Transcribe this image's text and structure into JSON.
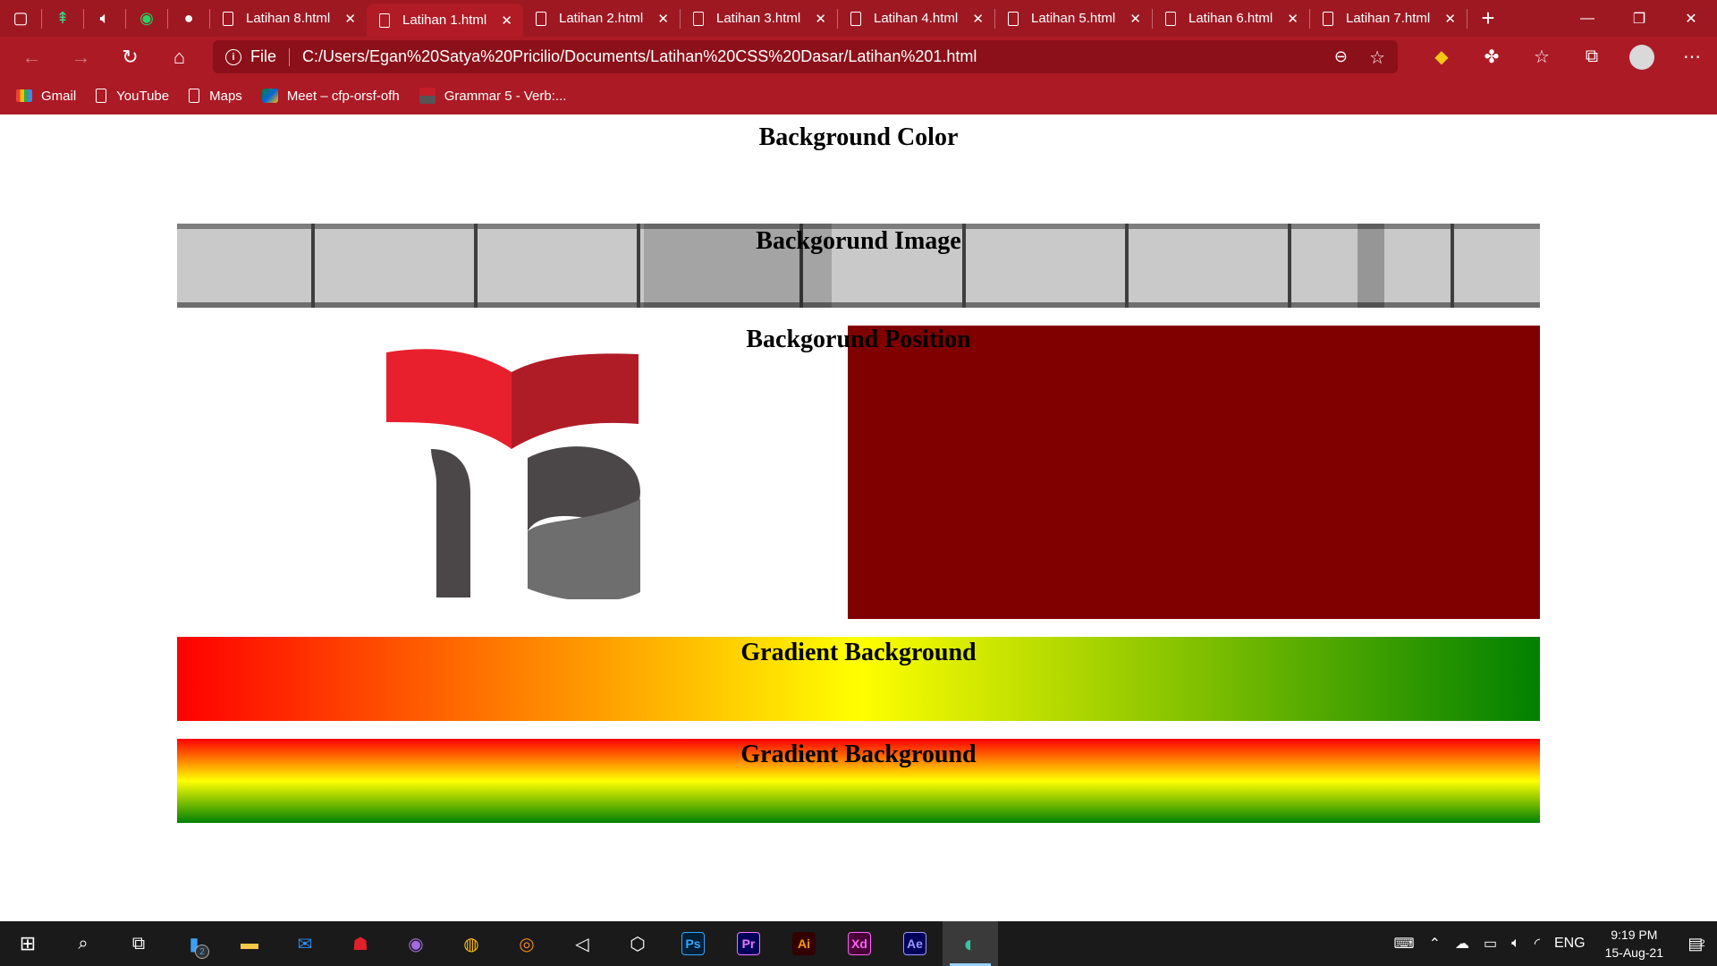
{
  "browser": {
    "tabs": [
      {
        "label": "Latihan 8.html",
        "active": false
      },
      {
        "label": "Latihan 1.html",
        "active": true
      },
      {
        "label": "Latihan 2.html",
        "active": false
      },
      {
        "label": "Latihan 3.html",
        "active": false
      },
      {
        "label": "Latihan 4.html",
        "active": false
      },
      {
        "label": "Latihan 5.html",
        "active": false
      },
      {
        "label": "Latihan 6.html",
        "active": false
      },
      {
        "label": "Latihan 7.html",
        "active": false
      }
    ],
    "address": {
      "scheme": "File",
      "url": "C:/Users/Egan%20Satya%20Pricilio/Documents/Latihan%20CSS%20Dasar/Latihan%201.html"
    },
    "bookmarks": [
      "Gmail",
      "YouTube",
      "Maps",
      "Meet – cfp-orsf-ofh",
      "Grammar 5 - Verb:..."
    ],
    "theme_color": "#ac1a25"
  },
  "page": {
    "sections": {
      "color_title": "Background Color",
      "image_title": "Backgorund Image",
      "position_title": "Backgorund Position",
      "gradient1_title": "Gradient Background",
      "gradient2_title": "Gradient Background"
    },
    "colors": {
      "position_box": "#800000",
      "gradient": [
        "#ff0000",
        "#ffff00",
        "#008000"
      ]
    }
  },
  "taskbar": {
    "apps": [
      "file-explorer",
      "mail",
      "browser-red",
      "github-desktop",
      "chrome",
      "blender",
      "unity",
      "visual-studio",
      "Ps",
      "Pr",
      "Ai",
      "Xd",
      "Ae",
      "edge"
    ],
    "badge_count": "2",
    "language": "ENG",
    "time": "9:19 PM",
    "date": "15-Aug-21",
    "notification_count": "2"
  }
}
